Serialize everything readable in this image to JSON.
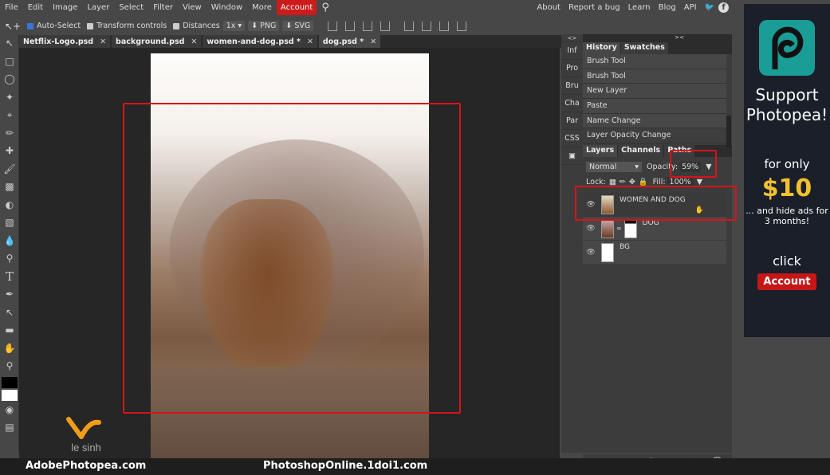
{
  "menu": {
    "items": [
      "File",
      "Edit",
      "Image",
      "Layer",
      "Select",
      "Filter",
      "View",
      "Window",
      "More"
    ],
    "account": "Account",
    "right_links": [
      "About",
      "Report a bug",
      "Learn",
      "Blog",
      "API"
    ]
  },
  "toolbar": {
    "auto_select": "Auto-Select",
    "auto_select_checked": true,
    "transform_controls": "Transform controls",
    "transform_checked": false,
    "distances": "Distances",
    "distances_checked": false,
    "zoom_select": "1x",
    "png_label": "PNG",
    "svg_label": "SVG"
  },
  "tabs": [
    {
      "label": "Netflix-Logo.psd"
    },
    {
      "label": "background.psd"
    },
    {
      "label": "women-and-dog.psd *"
    },
    {
      "label": "dog.psd *",
      "active": true
    }
  ],
  "side_strip": [
    "Inf",
    "Pro",
    "Bru",
    "Cha",
    "Par",
    "CSS"
  ],
  "history": {
    "tabs": [
      "History",
      "Swatches"
    ],
    "items": [
      "Brush Tool",
      "Brush Tool",
      "New Layer",
      "Paste",
      "Name Change",
      "Layer Opacity Change"
    ]
  },
  "layers": {
    "tabs": [
      "Layers",
      "Channels",
      "Paths"
    ],
    "blend_mode": "Normal",
    "opacity_label": "Opacity:",
    "opacity_value": "59%",
    "lock_label": "Lock:",
    "fill_label": "Fill:",
    "fill_value": "100%",
    "items": [
      {
        "name": "WOMEN AND DOG",
        "selected": true
      },
      {
        "name": "DOG"
      },
      {
        "name": "BG"
      }
    ]
  },
  "ad": {
    "headline": "Support Photopea!",
    "for_only": "for only",
    "price": "$10",
    "sub": "... and hide ads for 3 months!",
    "click": "click",
    "button": "Account"
  },
  "watermark": {
    "left": "AdobePhotopea.com",
    "right": "PhotoshopOnline.1doi1.com",
    "logo_text": "le sinh"
  },
  "colors": {
    "accent_red": "#cc1b1b",
    "highlight": "#d6141a",
    "ad_price": "#f2c12e"
  }
}
